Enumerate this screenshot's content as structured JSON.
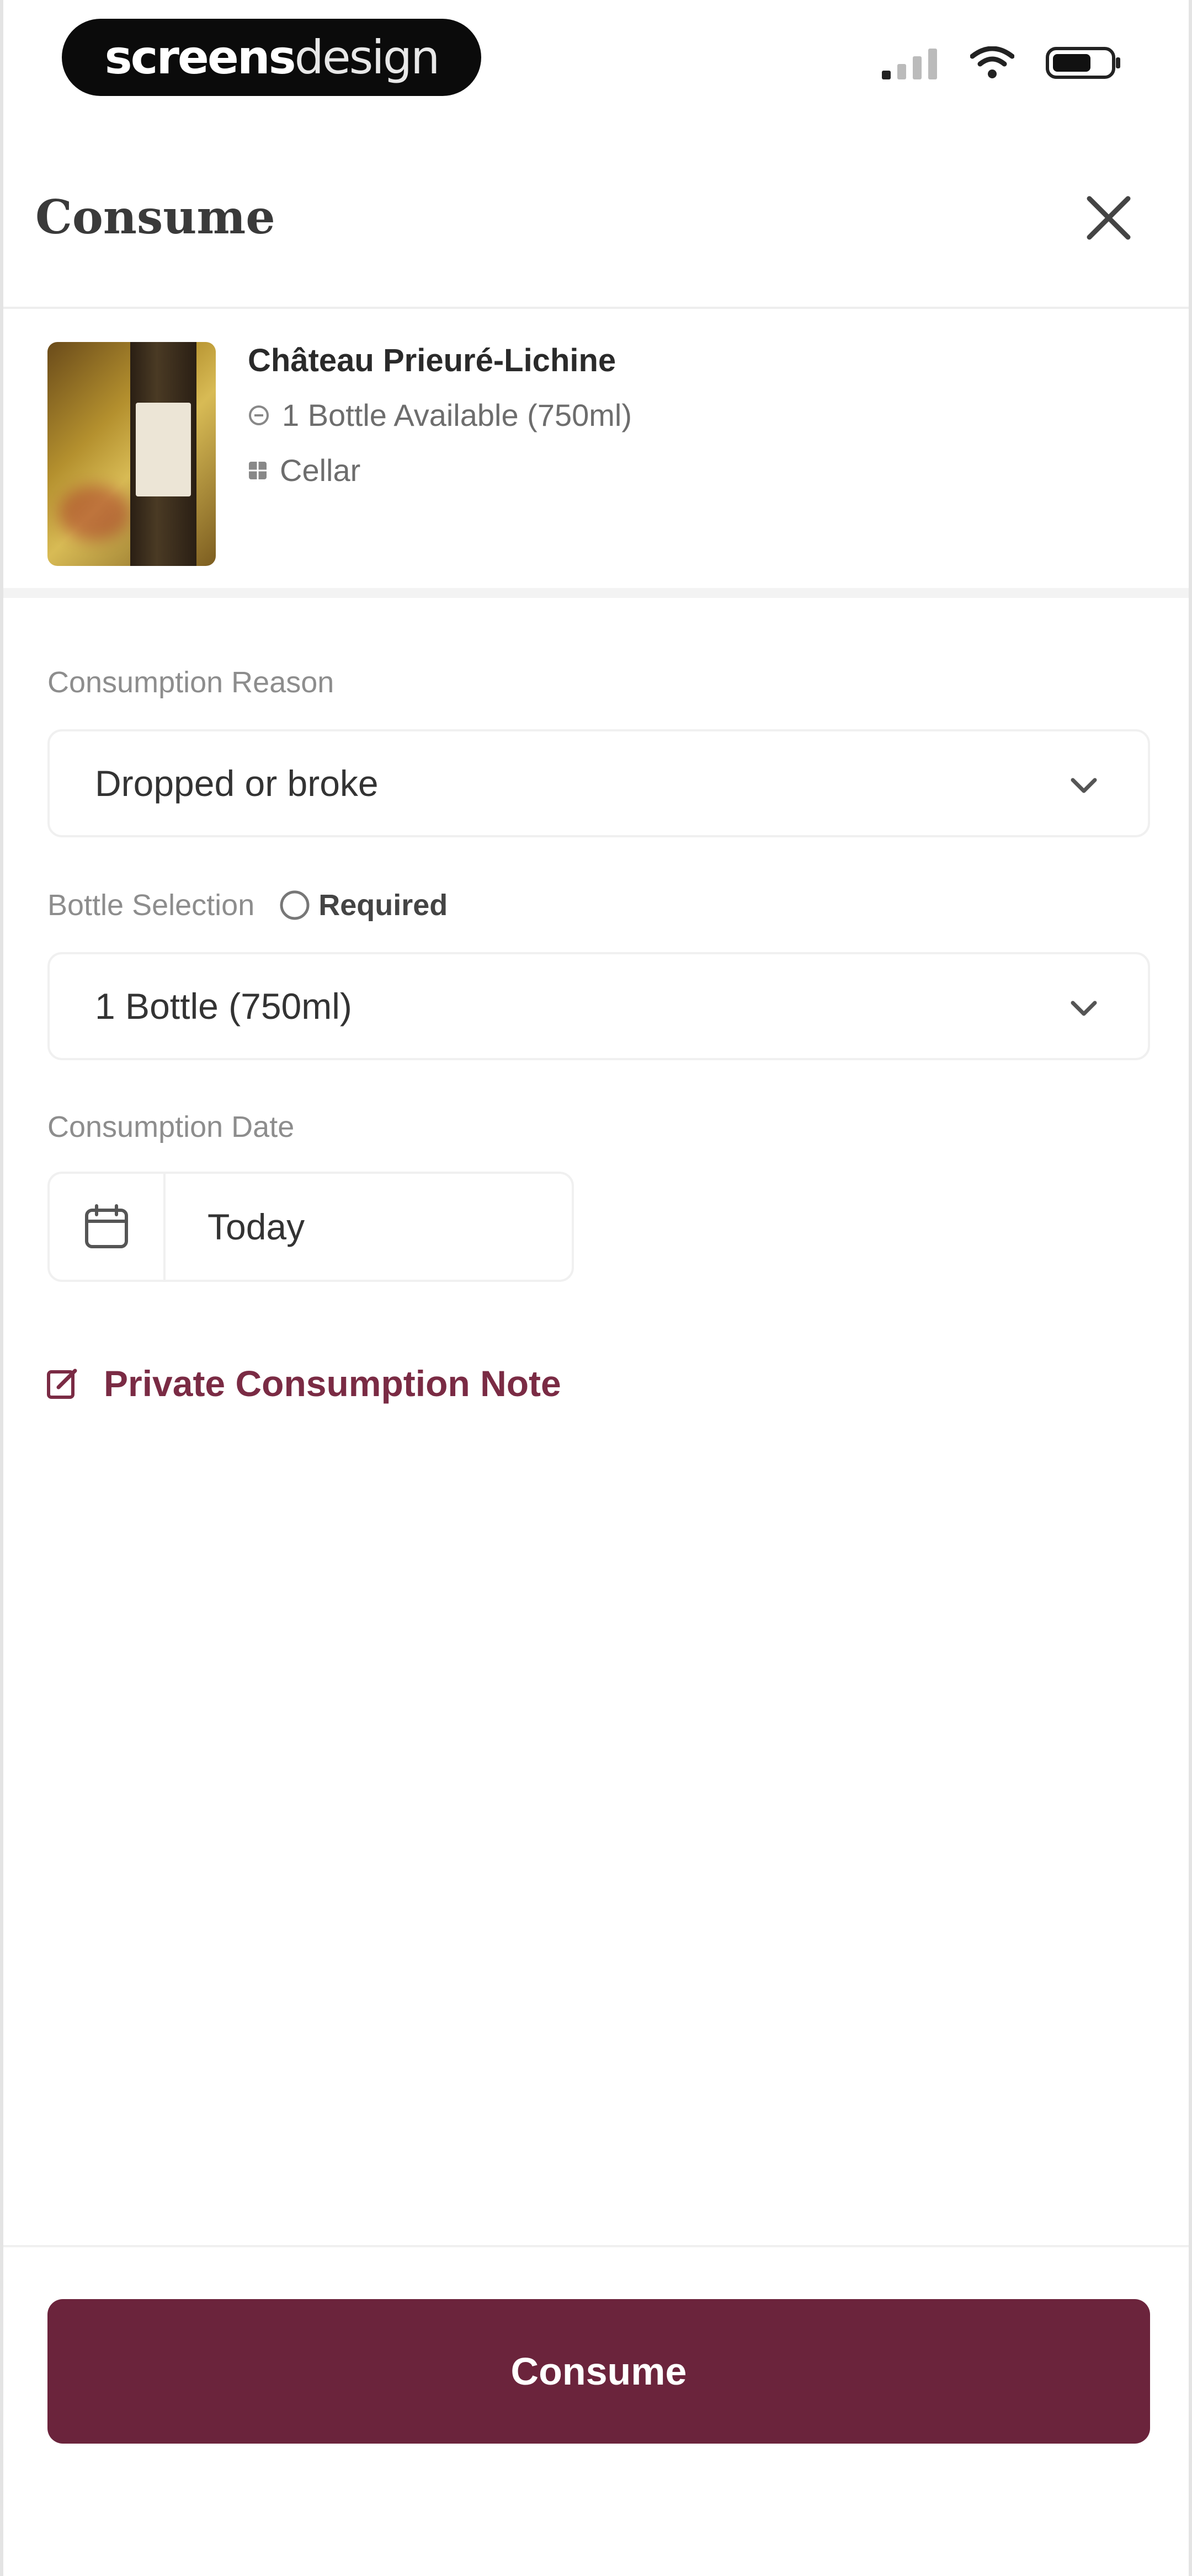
{
  "status_bar": {
    "brand_bold": "screens",
    "brand_light": "design"
  },
  "header": {
    "title": "Consume"
  },
  "wine": {
    "name": "Château Prieuré-Lichine",
    "availability": "1 Bottle Available (750ml)",
    "location": "Cellar"
  },
  "form": {
    "reason": {
      "label": "Consumption Reason",
      "value": "Dropped or broke"
    },
    "bottle": {
      "label": "Bottle Selection",
      "required": "Required",
      "value": "1 Bottle (750ml)"
    },
    "date": {
      "label": "Consumption Date",
      "value": "Today"
    },
    "note_link": "Private Consumption Note"
  },
  "footer": {
    "button_label": "Consume"
  },
  "colors": {
    "accent": "#6b243c",
    "link": "#7a2b44"
  }
}
